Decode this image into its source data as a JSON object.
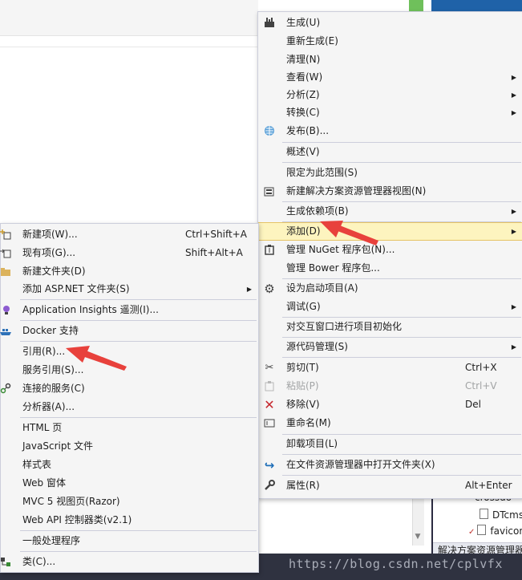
{
  "background": {
    "watermark": "https://blog.csdn.net/cplvfx",
    "solution_explorer": {
      "items": [
        "crossdo",
        "DTcms.",
        "favicon"
      ],
      "title": "解决方案资源管理器"
    }
  },
  "context_menu": {
    "items": [
      {
        "label": "生成(U)",
        "icon": "build-icon"
      },
      {
        "label": "重新生成(E)"
      },
      {
        "label": "清理(N)"
      },
      {
        "label": "查看(W)",
        "submenu": true
      },
      {
        "label": "分析(Z)",
        "submenu": true
      },
      {
        "label": "转换(C)",
        "submenu": true
      },
      {
        "label": "发布(B)...",
        "icon": "publish-icon"
      },
      {
        "label": "概述(V)"
      },
      {
        "label": "限定为此范围(S)"
      },
      {
        "label": "新建解决方案资源管理器视图(N)",
        "icon": "new-view-icon"
      },
      {
        "label": "生成依赖项(B)",
        "submenu": true
      },
      {
        "label": "添加(D)",
        "submenu": true,
        "highlighted": true
      },
      {
        "label": "管理 NuGet 程序包(N)...",
        "icon": "nuget-icon"
      },
      {
        "label": "管理 Bower 程序包..."
      },
      {
        "label": "设为启动项目(A)",
        "icon": "gear-icon"
      },
      {
        "label": "调试(G)",
        "submenu": true
      },
      {
        "label": "对交互窗口进行项目初始化"
      },
      {
        "label": "源代码管理(S)",
        "submenu": true
      },
      {
        "label": "剪切(T)",
        "shortcut": "Ctrl+X",
        "icon": "scissors-icon"
      },
      {
        "label": "粘贴(P)",
        "shortcut": "Ctrl+V",
        "icon": "paste-icon",
        "disabled": true
      },
      {
        "label": "移除(V)",
        "shortcut": "Del",
        "icon": "remove-icon"
      },
      {
        "label": "重命名(M)",
        "icon": "rename-icon"
      },
      {
        "label": "卸载项目(L)"
      },
      {
        "label": "在文件资源管理器中打开文件夹(X)",
        "icon": "open-folder-icon"
      },
      {
        "label": "属性(R)",
        "shortcut": "Alt+Enter",
        "icon": "wrench-icon"
      }
    ]
  },
  "add_submenu": {
    "items": [
      {
        "label": "新建项(W)...",
        "shortcut": "Ctrl+Shift+A",
        "icon": "new-item-icon"
      },
      {
        "label": "现有项(G)...",
        "shortcut": "Shift+Alt+A",
        "icon": "existing-item-icon"
      },
      {
        "label": "新建文件夹(D)",
        "icon": "new-folder-icon"
      },
      {
        "label": "添加 ASP.NET 文件夹(S)",
        "submenu": true
      },
      {
        "label": "Application Insights 遥测(I)...",
        "icon": "insights-icon"
      },
      {
        "label": "Docker 支持",
        "icon": "docker-icon"
      },
      {
        "label": "引用(R)..."
      },
      {
        "label": "服务引用(S)..."
      },
      {
        "label": "连接的服务(C)",
        "icon": "connected-service-icon"
      },
      {
        "label": "分析器(A)..."
      },
      {
        "label": "HTML 页"
      },
      {
        "label": "JavaScript 文件"
      },
      {
        "label": "样式表"
      },
      {
        "label": "Web 窗体"
      },
      {
        "label": "MVC 5 视图页(Razor)"
      },
      {
        "label": "Web API 控制器类(v2.1)"
      },
      {
        "label": "一般处理程序"
      },
      {
        "label": "类(C)...",
        "icon": "class-icon"
      }
    ]
  },
  "colors": {
    "menu_bg": "#f5f5f5",
    "highlight_bg": "#fdf4bf",
    "highlight_border": "#e5c365",
    "separator": "#cccedb",
    "annotation_arrow": "#e8413c"
  }
}
